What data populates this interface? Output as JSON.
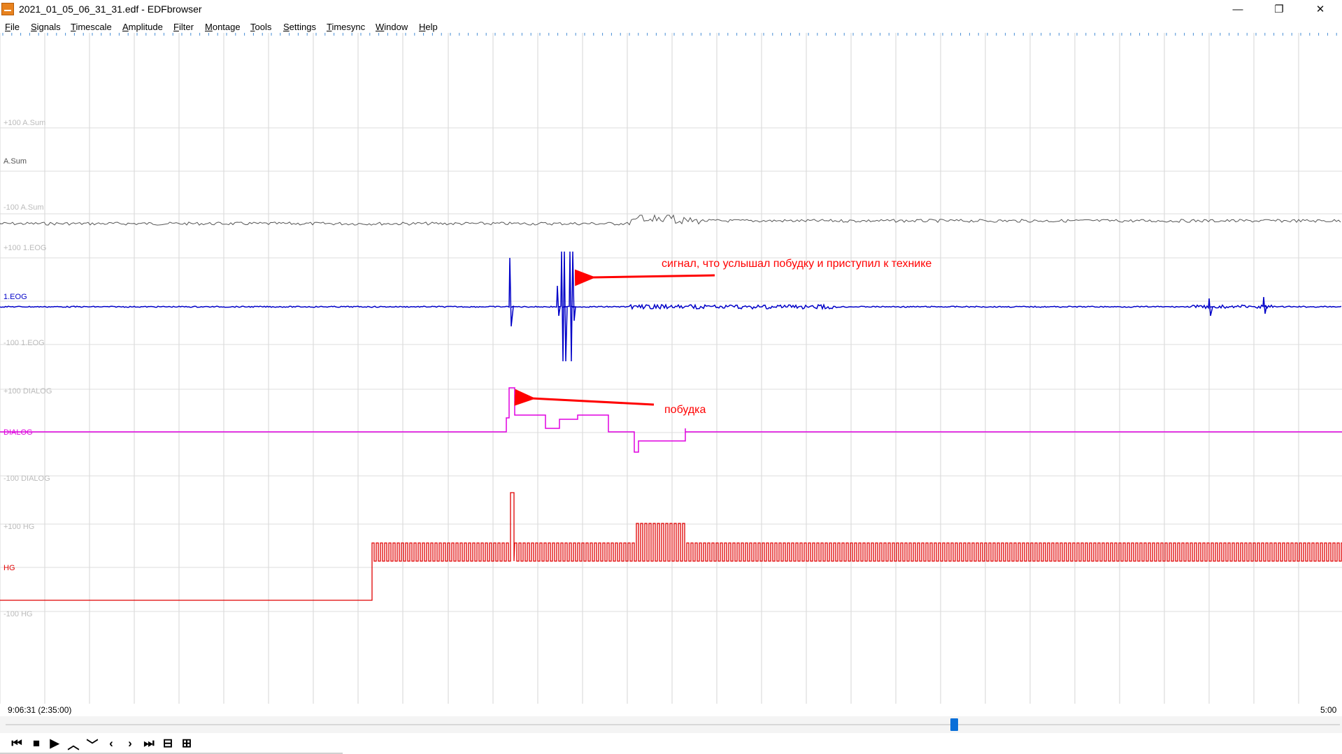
{
  "window": {
    "title": "2021_01_05_06_31_31.edf - EDFbrowser",
    "minimize_glyph": "—",
    "restore_glyph": "❐",
    "close_glyph": "✕"
  },
  "menu": [
    "File",
    "Signals",
    "Timescale",
    "Amplitude",
    "Filter",
    "Montage",
    "Tools",
    "Settings",
    "Timesync",
    "Window",
    "Help"
  ],
  "signals": [
    {
      "name": "A.Sum",
      "upper": "+100 A.Sum",
      "lower": "-100 A.Sum",
      "color": "#555555"
    },
    {
      "name": "1.EOG",
      "upper": "+100 1.EOG",
      "lower": "-100 1.EOG",
      "color": "#0000c8"
    },
    {
      "name": "DIALOG",
      "upper": "+100 DIALOG",
      "lower": "-100 DIALOG",
      "color": "#e000e0"
    },
    {
      "name": "HG",
      "upper": "+100 HG",
      "lower": "-100 HG",
      "color": "#e00000"
    }
  ],
  "annotations": [
    {
      "text": "сигнал, что услышал побудку и приступил к технике",
      "color": "#ff0000"
    },
    {
      "text": "побудка",
      "color": "#ff0000"
    }
  ],
  "timebar": {
    "start": "9:06:31 (2:35:00)",
    "end": "5:00"
  },
  "scroll": {
    "position_fraction": 0.712
  },
  "controls": [
    {
      "name": "go-to-start-icon",
      "glyph": "⏮"
    },
    {
      "name": "stop-icon",
      "glyph": "■"
    },
    {
      "name": "play-icon",
      "glyph": "▶"
    },
    {
      "name": "amplitude-up-icon",
      "glyph": "︿"
    },
    {
      "name": "amplitude-down-icon",
      "glyph": "﹀"
    },
    {
      "name": "page-back-icon",
      "glyph": "‹"
    },
    {
      "name": "page-forward-icon",
      "glyph": "›"
    },
    {
      "name": "go-to-end-icon",
      "glyph": "⏭"
    },
    {
      "name": "zoom-out-icon",
      "glyph": "⊟"
    },
    {
      "name": "zoom-in-icon",
      "glyph": "⊞"
    }
  ]
}
